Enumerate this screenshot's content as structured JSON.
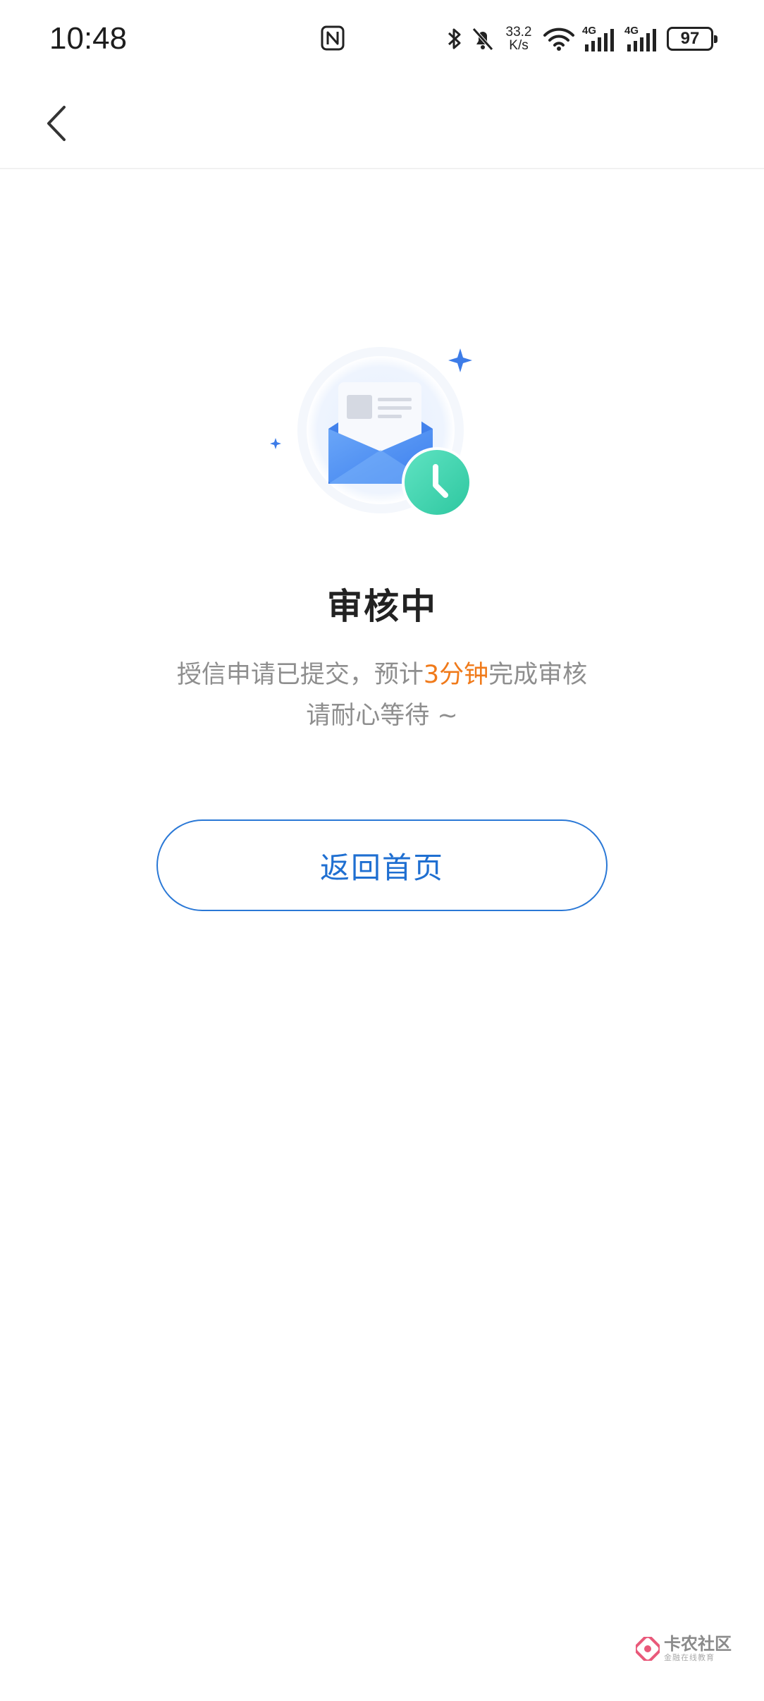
{
  "status_bar": {
    "time": "10:48",
    "net_speed_value": "33.2",
    "net_speed_unit": "K/s",
    "sim1_tag": "4G",
    "sim2_tag": "4G",
    "battery": "97"
  },
  "nav": {
    "back_icon": "chevron-left-icon"
  },
  "main": {
    "illustration_icon": "envelope-clock-icon",
    "title": "审核中",
    "desc_prefix": "授信申请已提交，预计",
    "desc_highlight": "3分钟",
    "desc_suffix": "完成审核",
    "desc_line2": "请耐心等待 ~",
    "home_button_label": "返回首页"
  },
  "watermark": {
    "main": "卡农社区",
    "sub": "金融在线教育"
  },
  "colors": {
    "accent_blue": "#1f6fd1",
    "highlight_orange": "#f07a1a",
    "clock_green": "#3fd6b0"
  }
}
